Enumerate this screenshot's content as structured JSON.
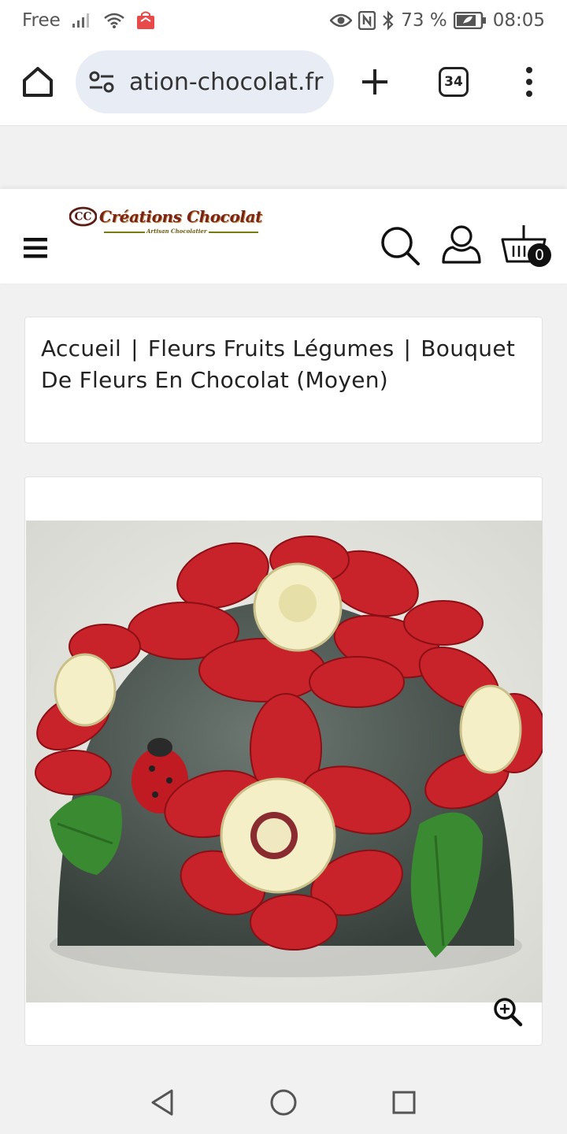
{
  "status_bar": {
    "carrier": "Free",
    "battery": "73 %",
    "time": "08:05",
    "icons": [
      "signal-icon",
      "wifi-icon",
      "shopping-bag-icon",
      "eye-icon",
      "nfc-icon",
      "bluetooth-icon",
      "battery-saver-icon"
    ]
  },
  "browser": {
    "url": "ation-chocolat.fr",
    "tab_count": "34",
    "icons": [
      "home-icon",
      "site-settings-icon",
      "plus-icon",
      "more-vert-icon"
    ]
  },
  "site": {
    "logo_text": "Créations Chocolat",
    "logo_subtitle": "Artisan Chocolatier",
    "cart_count": "0",
    "icons": [
      "hamburger-menu-icon",
      "search-icon",
      "user-icon",
      "cart-icon"
    ]
  },
  "breadcrumb": {
    "items": [
      "Accueil",
      "Fleurs Fruits Légumes",
      "Bouquet De Fleurs En Chocolat (Moyen)"
    ],
    "separator": "|"
  },
  "product": {
    "image_icon": "zoom-in-icon",
    "colors": {
      "petal_red": "#c8222a",
      "cream": "#f4efc6",
      "leaf_green": "#3a8a32",
      "dome_grey": "#4a5550"
    }
  },
  "nav_bar": {
    "icons": [
      "back-icon",
      "home-circle-icon",
      "recents-icon"
    ]
  }
}
